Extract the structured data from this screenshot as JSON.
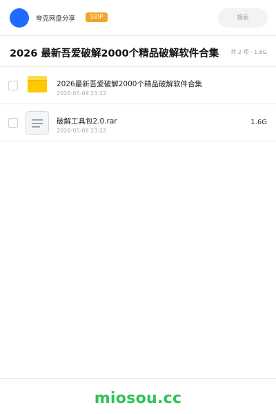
{
  "header": {
    "share_name": "夸克网盘分享",
    "badge": "SVIP",
    "search_placeholder": "搜索",
    "avatar_color": "#1f6bff"
  },
  "title": {
    "text": "2026 最新吾爱破解2000个精品破解软件合集",
    "summary": "共 2 项 · 1.6G"
  },
  "files": [
    {
      "name": "2026最新吾爱破解2000个精品破解软件合集",
      "date": "2026-05-09 23:22",
      "size": "",
      "icon": "folder-icon"
    },
    {
      "name": "破解工具包2.0.rar",
      "date": "2026-05-09 23:22",
      "size": "1.6G",
      "icon": "document-icon"
    }
  ],
  "footer": {
    "watermark": "miosou.cc"
  },
  "colors": {
    "badge": "#f5a42a",
    "folder": "#ffc800",
    "watermark": "#2ec25a"
  }
}
